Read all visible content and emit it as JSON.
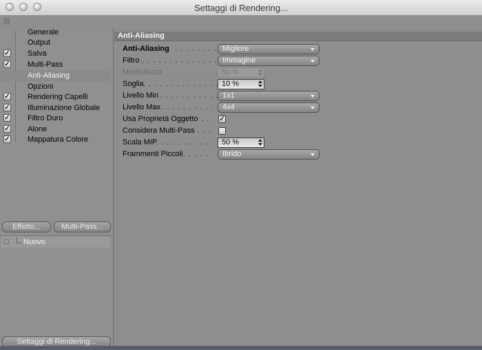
{
  "window": {
    "title": "Settaggi di Rendering..."
  },
  "sidebar": {
    "items": [
      {
        "label": "Generale",
        "checked": false
      },
      {
        "label": "Output",
        "checked": false
      },
      {
        "label": "Salva",
        "checked": true
      },
      {
        "label": "Multi-Pass",
        "checked": true
      },
      {
        "label": "Anti-Aliasing",
        "checked": false,
        "selected": true
      },
      {
        "label": "Opzioni",
        "checked": false
      },
      {
        "label": "Rendering Capelli",
        "checked": true
      },
      {
        "label": "Illuminazione Globale",
        "checked": true
      },
      {
        "label": "Filtro Duro",
        "checked": true
      },
      {
        "label": "Alone",
        "checked": true
      },
      {
        "label": "Mappatura Colore",
        "checked": true
      }
    ],
    "check_glyph": "✓",
    "effect_button": "Effetto...",
    "multipass_button": "Multi-Pass...",
    "tree_item": "Nuovo",
    "bottom_button": "Settaggi di Rendering..."
  },
  "panel": {
    "section_title": "Anti-Aliasing",
    "rows": [
      {
        "label": "Anti-Aliasing",
        "dots": " . . . . . . . .",
        "kind": "dropdown",
        "value": "Migliore",
        "bold": true
      },
      {
        "label": "Filtro",
        "dots": " . . . . . . . . . . . . . . .",
        "kind": "dropdown",
        "value": "Immagine"
      },
      {
        "label": "Morbidezza",
        "dots": " . . . . . . . . . . .",
        "kind": "spinner",
        "value": "50 %",
        "disabled": true
      },
      {
        "label": "Soglia",
        "dots": " . . . . . . . . . . . . . . .",
        "kind": "spinner",
        "value": "10 %"
      },
      {
        "label": "Livello Min",
        "dots": " . . . . . . . . . . . .",
        "kind": "dropdown",
        "value": "1x1"
      },
      {
        "label": "Livello Max",
        "dots": " . . . . . . . . . . .",
        "kind": "dropdown",
        "value": "4x4"
      },
      {
        "label": "Usa Proprietà Oggetto",
        "dots": " . .",
        "kind": "checkbox",
        "checked": true
      },
      {
        "label": "Considera Multi-Pass",
        "dots": " . . .",
        "kind": "checkbox",
        "checked": false
      },
      {
        "label": "Scala MIP",
        "dots": " . . . . . . . . . . . . .",
        "kind": "spinner",
        "value": "50 %"
      },
      {
        "label": "Frammenti Piccoli",
        "dots": " . . . . .",
        "kind": "dropdown",
        "value": "Ibrido"
      }
    ]
  },
  "icons": {
    "window_close": "close-icon",
    "window_minimize": "minimize-icon",
    "window_zoom": "zoom-icon",
    "grip": "grip-icon",
    "dropdown_arrow": "chevron-down-icon",
    "spinner": "stepper-icon",
    "check": "check-icon"
  }
}
